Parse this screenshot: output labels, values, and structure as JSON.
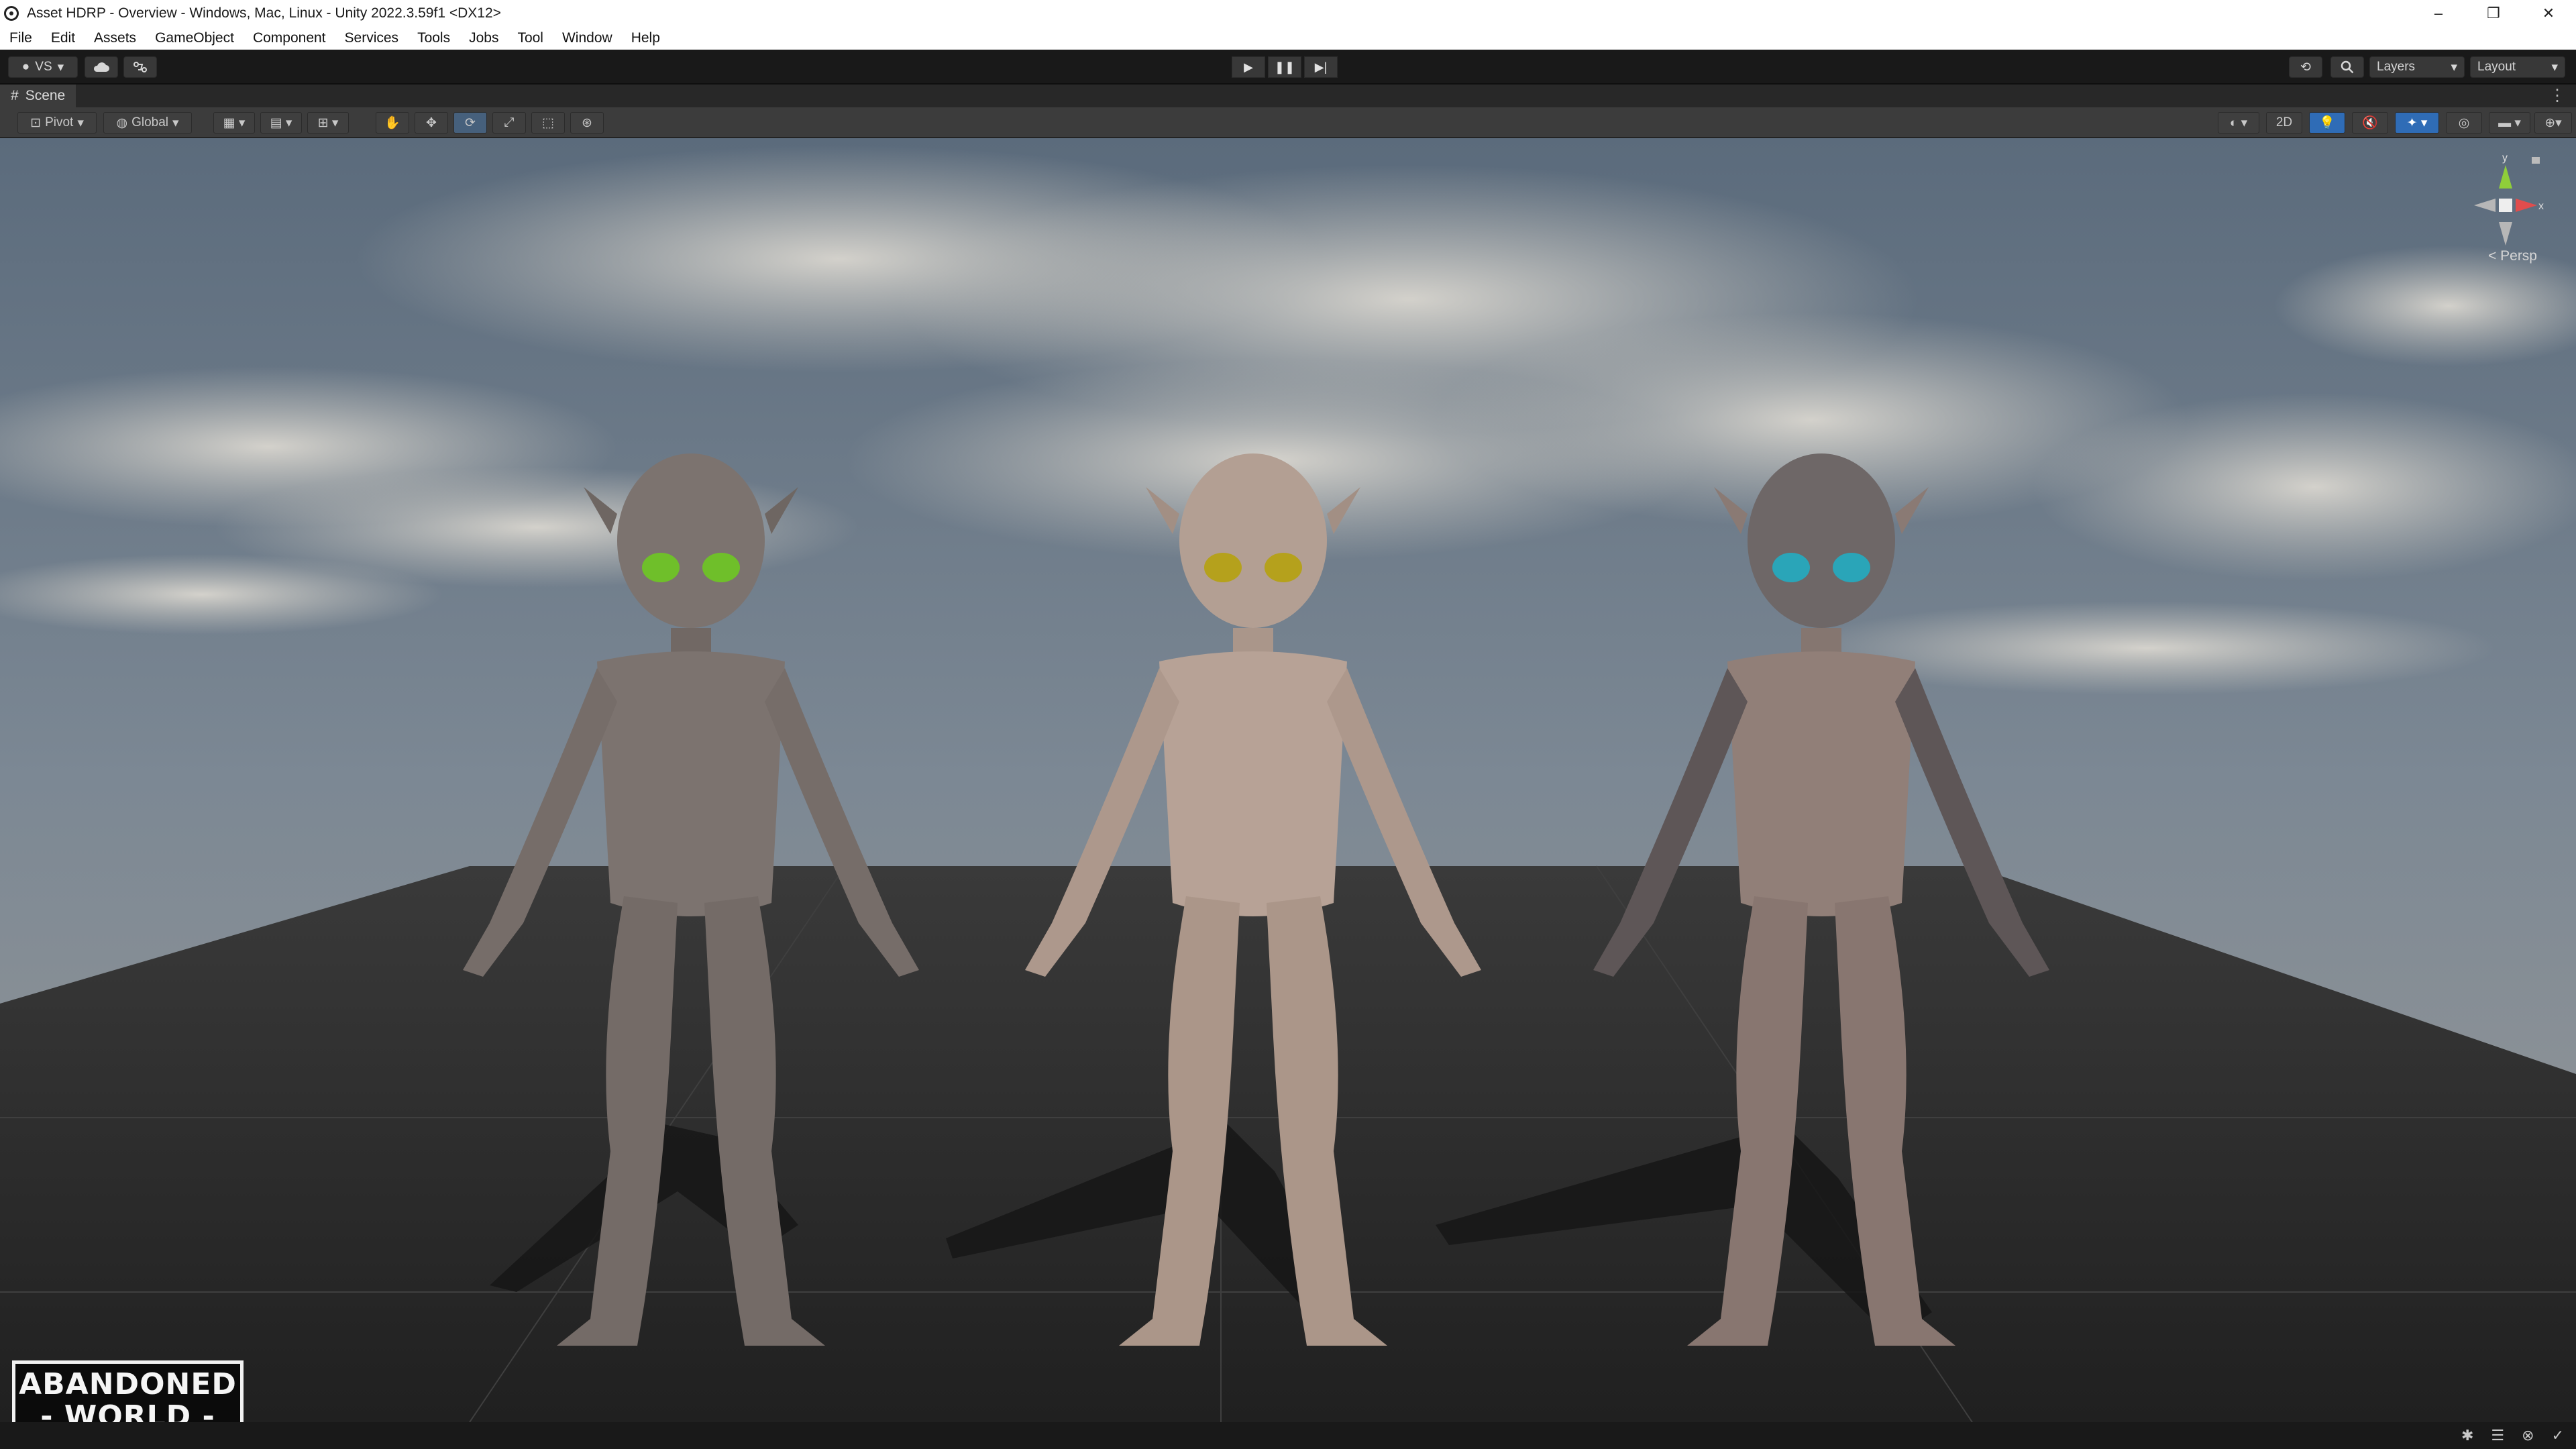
{
  "window": {
    "title": "Asset HDRP - Overview - Windows, Mac, Linux - Unity 2022.3.59f1 <DX12>",
    "controls": [
      "–",
      "❐",
      "✕"
    ]
  },
  "menu": [
    "File",
    "Edit",
    "Assets",
    "GameObject",
    "Component",
    "Services",
    "Tools",
    "Jobs",
    "Tool",
    "Window",
    "Help"
  ],
  "toolbar": {
    "account_label": "VS",
    "layers_label": "Layers",
    "layout_label": "Layout",
    "icons": [
      "account-icon",
      "cloud-icon",
      "collab-icon",
      "play-icon",
      "pause-icon",
      "step-icon",
      "history-icon",
      "search-icon"
    ]
  },
  "scene_tab": {
    "label": "Scene"
  },
  "scene_toolbar": {
    "pivot_label": "Pivot",
    "global_label": "Global",
    "mode_2d_label": "2D"
  },
  "viewport": {
    "gizmo_axes": {
      "y": "y",
      "x": "x"
    },
    "projection_label": "< Persp",
    "logo_line1": "ABANDONED",
    "logo_line2": "- WORLD -",
    "characters": [
      "alien-creature-grey",
      "alien-creature-pale",
      "alien-creature-dark"
    ]
  },
  "colors": {
    "sky": "#6f7d8c",
    "floor": "#2b2b2b",
    "accent_blue": "#2f6cb6",
    "skin_grey": "#7c736f",
    "skin_pale": "#b59f93",
    "skin_dark": "#8a7a74"
  }
}
